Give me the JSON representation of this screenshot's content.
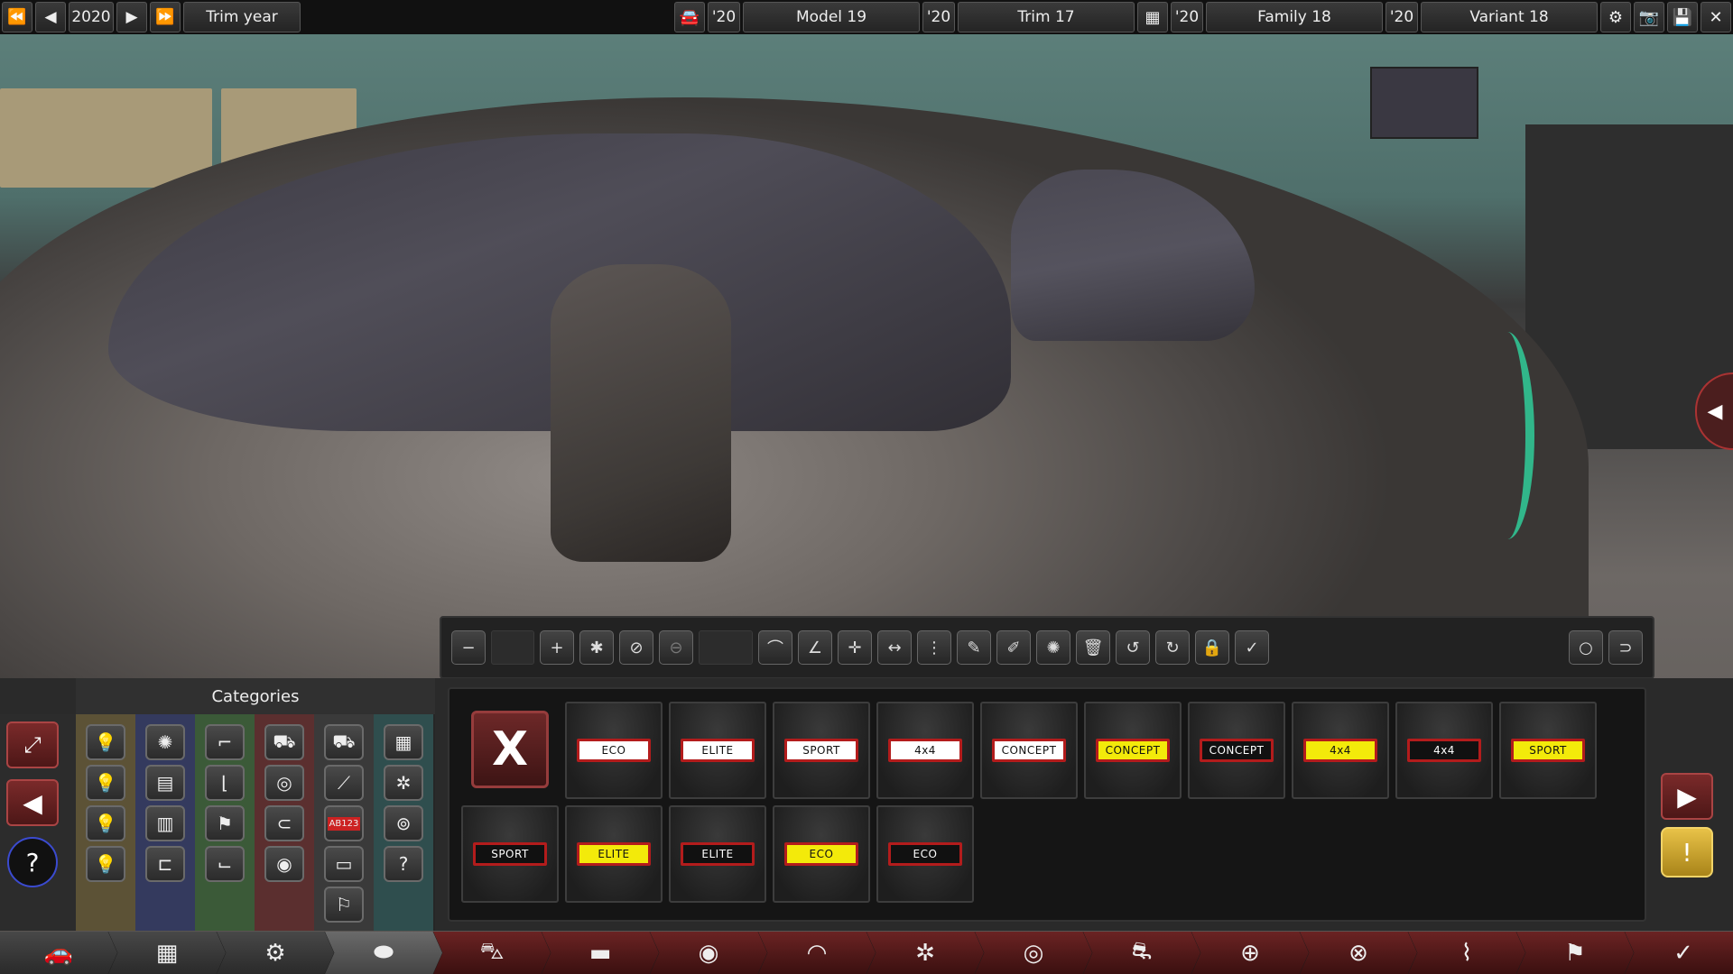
{
  "topbar": {
    "year": "2020",
    "trim_year_label": "Trim year",
    "model_year": "'20",
    "model_name": "Model 19",
    "trim_year": "'20",
    "trim_name": "Trim 17",
    "family_year": "'20",
    "family_name": "Family 18",
    "variant_year": "'20",
    "variant_name": "Variant 18",
    "icons": [
      "rewind-icon",
      "step-back-icon",
      "step-forward-icon",
      "fast-forward-icon",
      "car-icon",
      "engine-icon",
      "gear-icon",
      "camera-icon",
      "save-icon",
      "close-icon"
    ]
  },
  "categories": {
    "title": "Categories",
    "column_colors": [
      "#5c5236",
      "#343a5e",
      "#3b5a38",
      "#5b2f2f",
      "#3a3a3a",
      "#2f4e4e"
    ]
  },
  "badges": [
    {
      "text": "ECO",
      "style": "white"
    },
    {
      "text": "ELITE",
      "style": "white"
    },
    {
      "text": "SPORT",
      "style": "white"
    },
    {
      "text": "4x4",
      "style": "white"
    },
    {
      "text": "CONCEPT",
      "style": "white"
    },
    {
      "text": "CONCEPT",
      "style": "yellow"
    },
    {
      "text": "CONCEPT",
      "style": "black"
    },
    {
      "text": "4x4",
      "style": "yellow"
    },
    {
      "text": "4x4",
      "style": "black"
    },
    {
      "text": "SPORT",
      "style": "yellow"
    },
    {
      "text": "SPORT",
      "style": "black"
    },
    {
      "text": "ELITE",
      "style": "yellow"
    },
    {
      "text": "ELITE",
      "style": "black"
    },
    {
      "text": "ECO",
      "style": "yellow"
    },
    {
      "text": "ECO",
      "style": "black"
    }
  ],
  "colors": {
    "accent_red": "#a33333",
    "plate_yellow": "#f3ea0a",
    "warning_gold": "#e8c248"
  }
}
